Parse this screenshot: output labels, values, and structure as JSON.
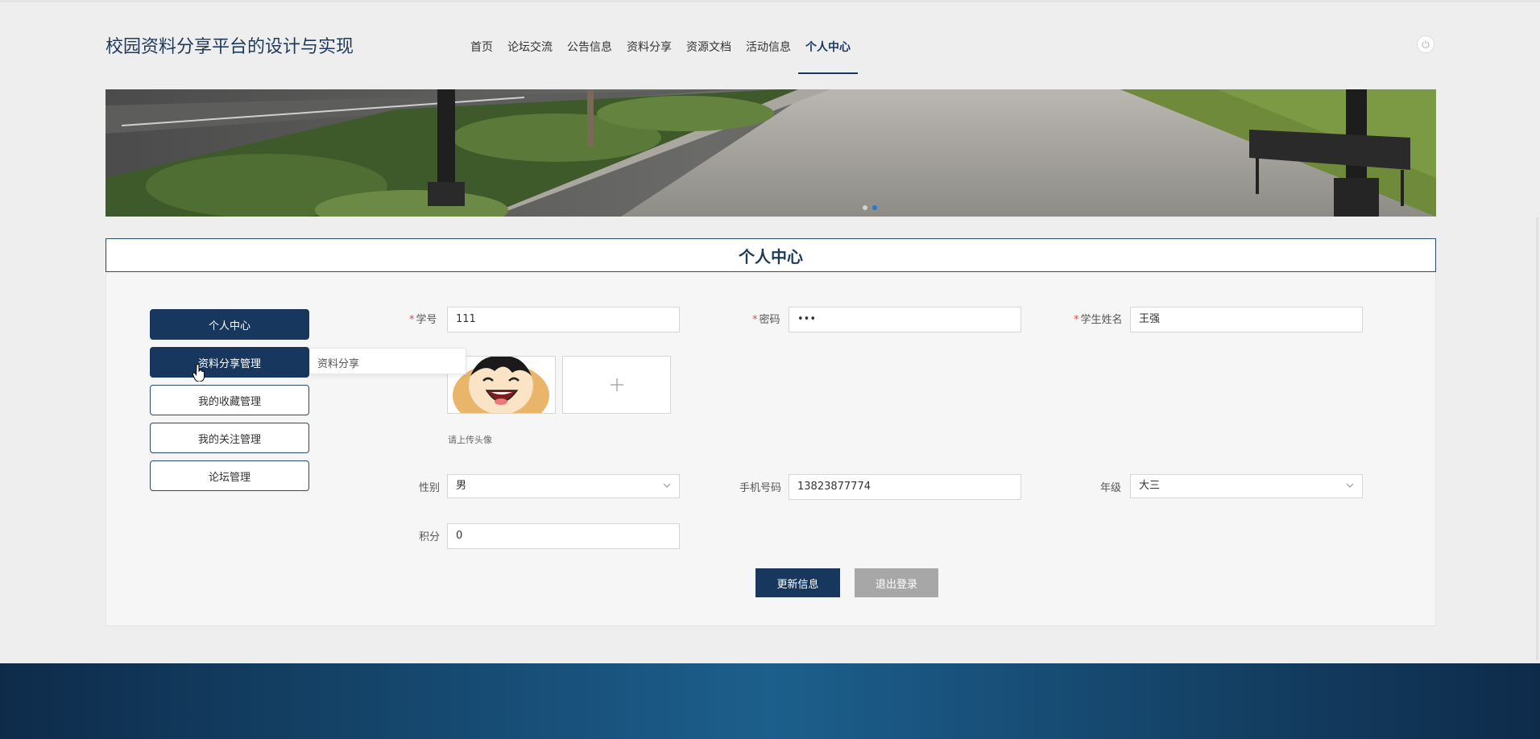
{
  "header": {
    "site_title": "校园资料分享平台的设计与实现",
    "nav": [
      {
        "label": "首页",
        "active": false
      },
      {
        "label": "论坛交流",
        "active": false
      },
      {
        "label": "公告信息",
        "active": false
      },
      {
        "label": "资料分享",
        "active": false
      },
      {
        "label": "资源文档",
        "active": false
      },
      {
        "label": "活动信息",
        "active": false
      },
      {
        "label": "个人中心",
        "active": true
      }
    ],
    "power_icon": "power-icon"
  },
  "banner": {
    "slide_count": 2,
    "active_slide": 2
  },
  "section": {
    "title": "个人中心"
  },
  "sidebar": {
    "items": [
      {
        "label": "个人中心"
      },
      {
        "label": "资料分享管理"
      },
      {
        "label": "我的收藏管理"
      },
      {
        "label": "我的关注管理"
      },
      {
        "label": "论坛管理"
      }
    ],
    "submenu": {
      "label": "资料分享"
    }
  },
  "form": {
    "student_id": {
      "label": "学号",
      "required": true,
      "value": "111"
    },
    "password": {
      "label": "密码",
      "required": true,
      "value": "•••"
    },
    "student_name": {
      "label": "学生姓名",
      "required": true,
      "value": "王强"
    },
    "avatar": {
      "hint": "请上传头像",
      "add_icon": "plus-icon"
    },
    "gender": {
      "label": "性别",
      "value": "男"
    },
    "phone": {
      "label": "手机号码",
      "value": "13823877774"
    },
    "grade": {
      "label": "年级",
      "value": "大三"
    },
    "points": {
      "label": "积分",
      "value": "0"
    }
  },
  "actions": {
    "update_label": "更新信息",
    "logout_label": "退出登录"
  },
  "colors": {
    "brand": "#17375e",
    "required_mark": "#e84a4a",
    "logout_button": "#a7a7a7"
  }
}
